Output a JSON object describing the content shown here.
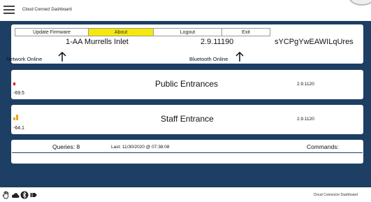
{
  "app": {
    "title": "Cloud Connect Dashboard"
  },
  "tabs": [
    "Update Firmware",
    "About",
    "Logout",
    "Exit"
  ],
  "active_tab": "About",
  "device": {
    "name": "1-AA Murrells Inlet",
    "version": "2.9.11190",
    "id": "sYCPgYwEAWILqUres"
  },
  "status": {
    "network": "Network Online",
    "bluetooth": "Bluetooth Online"
  },
  "entrances": [
    {
      "name": "Public Entrances",
      "rssi": "-69.5",
      "version": "2.9.1120",
      "signal_color": "#e0102a"
    },
    {
      "name": "Staff Entrance",
      "rssi": "-64.1",
      "version": "2.9.1120",
      "signal_color": "#f0a020"
    }
  ],
  "queries": {
    "count_label": "Queries: 8",
    "last_label": "Last: 11/30/2020 @ 07:38:08",
    "commands_label": "Commands:"
  },
  "footer": {
    "text": "Cloud Connector Dashboard",
    "icons": [
      "hand-icon",
      "cloud-icon",
      "bluetooth-icon",
      "tag-icon"
    ]
  },
  "colors": {
    "background": "#1c3f63",
    "active_tab": "#f5e90b"
  }
}
